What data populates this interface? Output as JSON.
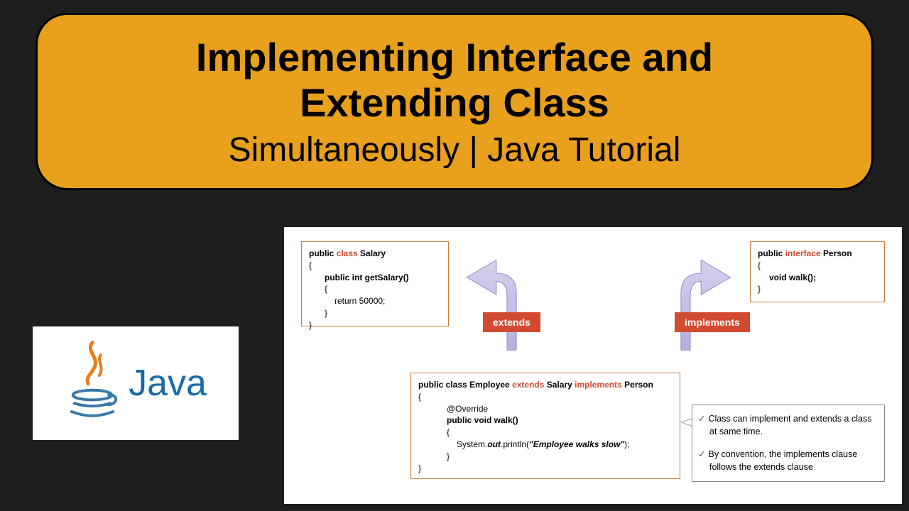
{
  "title": {
    "line1": "Implementing Interface and",
    "line2": "Extending Class",
    "sub": "Simultaneously | Java Tutorial"
  },
  "logo": {
    "text": "Java"
  },
  "diagram": {
    "salary_box": {
      "sig_prefix": "public ",
      "sig_kw": "class",
      "sig_name": " Salary",
      "method": "public int getSalary()",
      "ret": "return 50000;"
    },
    "person_box": {
      "sig_prefix": "public ",
      "sig_kw": "interface",
      "sig_name": " Person",
      "method": "void walk();"
    },
    "employee_box": {
      "sig_prefix": "public class Employee ",
      "extends_kw": "extends",
      "mid": " Salary ",
      "implements_kw": "implements",
      "end": " Person",
      "annot": "@Override",
      "method": "public void walk()",
      "stmt_prefix": "System.",
      "stmt_out": "out",
      "stmt_mid": ".println(",
      "stmt_str": "\"Employee walks slow\"",
      "stmt_end": ");"
    },
    "badges": {
      "extends": "extends",
      "implements": "implements"
    },
    "notes": {
      "n1": "Class can implement and extends a class at same time.",
      "n2": "By convention, the implements clause follows the extends clause"
    }
  }
}
